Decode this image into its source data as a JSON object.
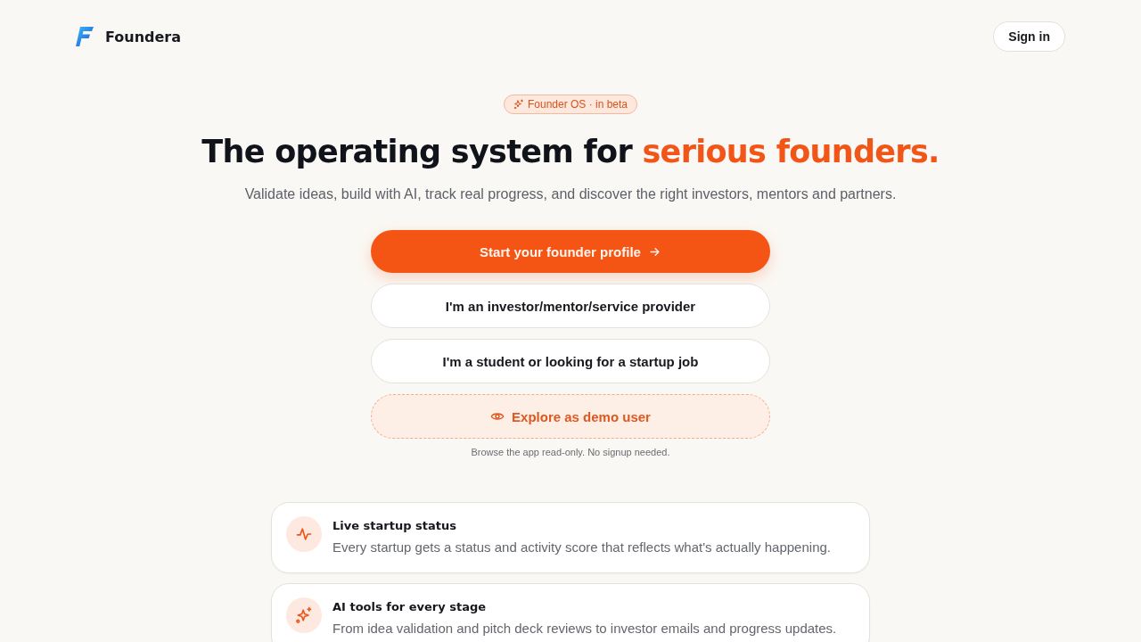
{
  "header": {
    "brand": "Foundera",
    "sign_in": "Sign in"
  },
  "hero": {
    "badge": "Founder OS · in beta",
    "heading": {
      "lead": "The operating system for",
      "highlight": "serious founders."
    },
    "subtitle": "Validate ideas, build with AI, track real progress, and discover the right investors, mentors and partners.",
    "actions": [
      {
        "kind": "primary",
        "label": "Start your founder profile"
      },
      {
        "kind": "secondary",
        "label": "I'm an investor/mentor/service provider"
      },
      {
        "kind": "secondary",
        "label": "I'm a student or looking for a startup job"
      },
      {
        "kind": "demo",
        "label": "Explore as demo user"
      }
    ],
    "note": "Browse the app read-only. No signup needed."
  },
  "features": [
    {
      "title": "Live startup status",
      "description": "Every startup gets a status and activity score that reflects what's actually happening."
    },
    {
      "title": "AI tools for every stage",
      "description": "From idea validation and pitch deck reviews to investor emails and progress updates."
    }
  ]
}
